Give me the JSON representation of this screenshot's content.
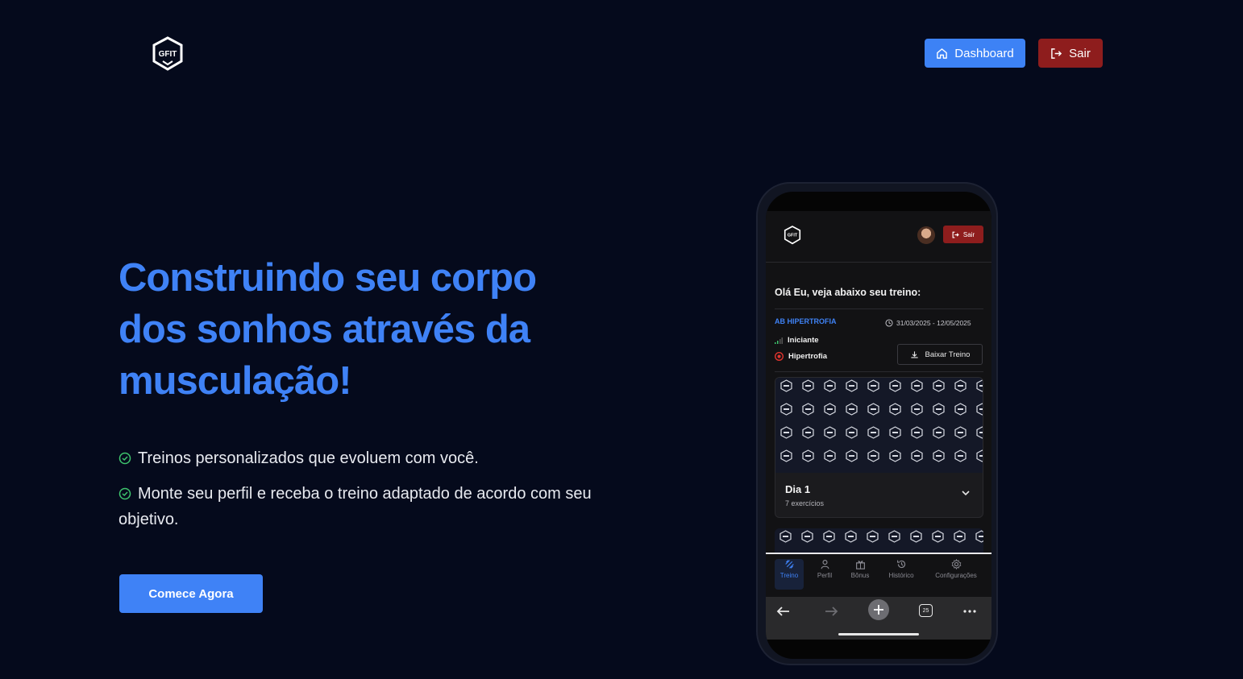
{
  "header": {
    "logo_text": "GFIT",
    "dashboard_label": "Dashboard",
    "sair_label": "Sair"
  },
  "hero": {
    "title": "Construindo seu corpo dos sonhos através da musculação!",
    "features": [
      "Treinos personalizados que evoluem com você.",
      "Monte seu perfil e receba o treino adaptado de acordo com seu objetivo."
    ],
    "cta_label": "Comece Agora"
  },
  "phone": {
    "logo_text": "GFIT",
    "sair_label": "Sair",
    "greeting": "Olá Eu, veja abaixo seu treino:",
    "plan_name": "AB HIPERTROFIA",
    "plan_dates": "31/03/2025 - 12/05/2025",
    "level": "Iniciante",
    "goal": "Hipertrofia",
    "download_label": "Baixar Treino",
    "day": {
      "title": "Dia 1",
      "subtitle": "7 exercícios"
    },
    "tabs": [
      {
        "label": "Treino",
        "icon": "dumbbell-icon",
        "active": true
      },
      {
        "label": "Perfil",
        "icon": "user-icon"
      },
      {
        "label": "Bônus",
        "icon": "gift-icon"
      },
      {
        "label": "Histórico",
        "icon": "history-icon"
      },
      {
        "label": "Configurações",
        "icon": "gear-icon"
      }
    ],
    "browser_tab_count": "25"
  },
  "colors": {
    "background": "#050a1c",
    "accent": "#3f82f6",
    "danger": "#8e1d1d",
    "success": "#3ec46d"
  }
}
